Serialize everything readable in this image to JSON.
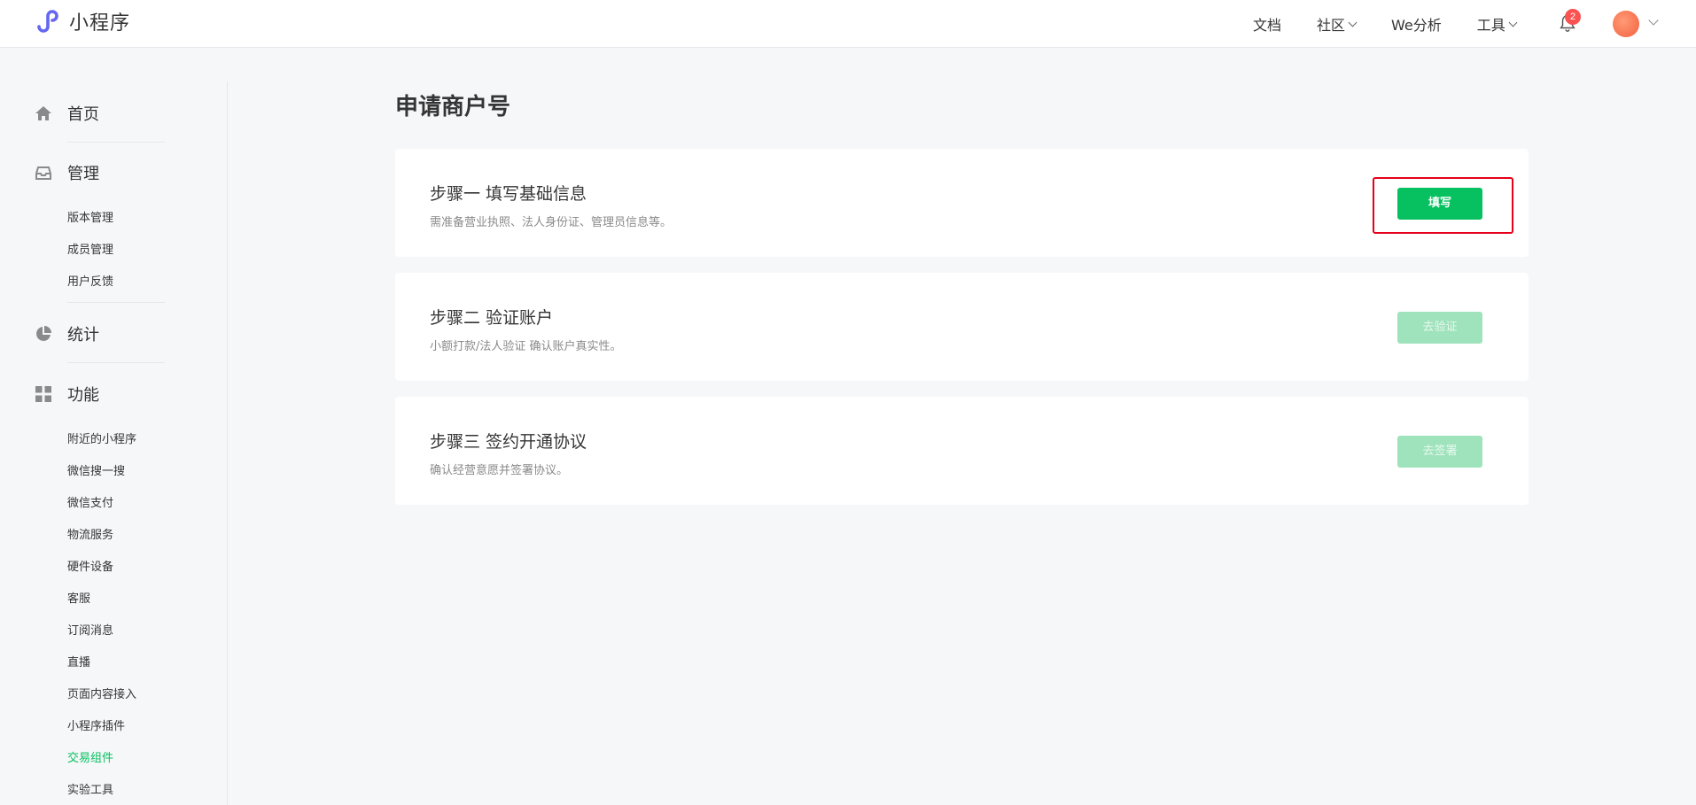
{
  "app": {
    "name": "小程序"
  },
  "topnav": {
    "docs": "文档",
    "community": "社区",
    "analytics": "We分析",
    "tools": "工具",
    "notification_count": "2"
  },
  "sidebar": {
    "sections": [
      {
        "label": "首页",
        "icon": "home-icon"
      },
      {
        "label": "管理",
        "icon": "inbox-icon",
        "items": [
          "版本管理",
          "成员管理",
          "用户反馈"
        ]
      },
      {
        "label": "统计",
        "icon": "pie-chart-icon"
      },
      {
        "label": "功能",
        "icon": "grid-icon",
        "items": [
          "附近的小程序",
          "微信搜一搜",
          "微信支付",
          "物流服务",
          "硬件设备",
          "客服",
          "订阅消息",
          "直播",
          "页面内容接入",
          "小程序插件",
          "交易组件",
          "实验工具"
        ]
      }
    ],
    "active_item": "交易组件"
  },
  "main": {
    "title": "申请商户号",
    "steps": [
      {
        "title": "步骤一 填写基础信息",
        "desc": "需准备营业执照、法人身份证、管理员信息等。",
        "button": "填写",
        "enabled": true
      },
      {
        "title": "步骤二 验证账户",
        "desc": "小额打款/法人验证 确认账户真实性。",
        "button": "去验证",
        "enabled": false
      },
      {
        "title": "步骤三 签约开通协议",
        "desc": "确认经营意愿并签署协议。",
        "button": "去签署",
        "enabled": false
      }
    ]
  },
  "colors": {
    "accent": "#07c160",
    "disabled": "#9ee3bb",
    "highlight": "#e6001b",
    "badge": "#fa5151"
  }
}
